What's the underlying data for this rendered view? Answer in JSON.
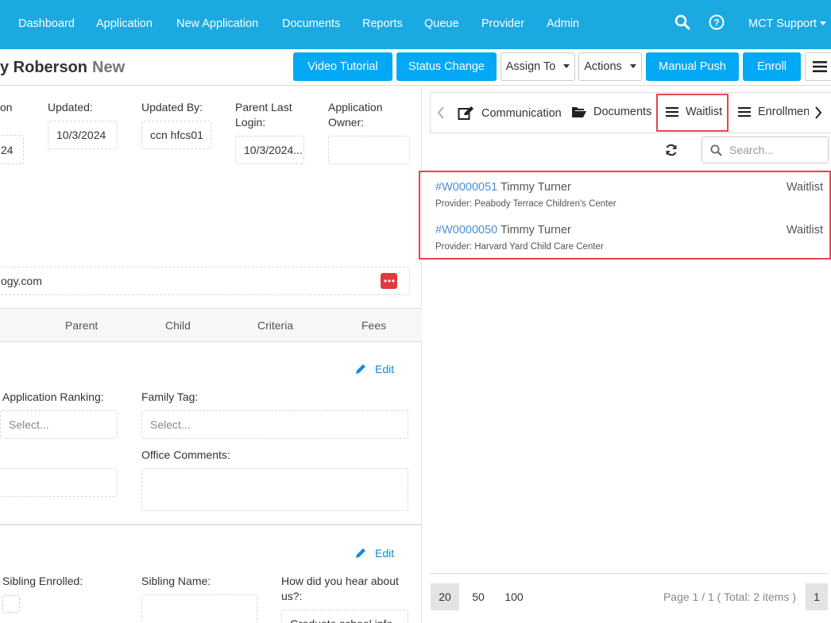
{
  "nav": {
    "items": [
      "Dashboard",
      "Application",
      "New Application",
      "Documents",
      "Reports",
      "Queue",
      "Provider",
      "Admin"
    ],
    "user": "MCT Support"
  },
  "header": {
    "title": "y Roberson",
    "status": "New",
    "buttons": {
      "video": "Video Tutorial",
      "status_change": "Status Change",
      "assign_to": "Assign To",
      "actions": "Actions",
      "manual_push": "Manual Push",
      "enroll": "Enroll"
    }
  },
  "form": {
    "on_label": "on",
    "on_value": "24",
    "updated_label": "Updated:",
    "updated_value": "10/3/2024",
    "updated_by_label": "Updated By:",
    "updated_by_value": "ccn hfcs01",
    "parent_login_label": "Parent Last Login:",
    "parent_login_value": "10/3/2024...",
    "owner_label": "Application Owner:",
    "owner_value": "",
    "email_value": "ogy.com",
    "tabs": [
      "Parent",
      "Child",
      "Criteria",
      "Fees"
    ],
    "edit_label": "Edit",
    "ranking_label": "Application Ranking:",
    "ranking_placeholder": "Select...",
    "family_tag_label": "Family Tag:",
    "family_tag_placeholder": "Select...",
    "office_comments_label": "Office Comments:",
    "sibling_enrolled_label": "Sibling Enrolled:",
    "sibling_name_label": "Sibling Name:",
    "hear_about_label": "How did you hear about us?:",
    "hear_about_value": "Graduate school info..."
  },
  "right": {
    "tabs": {
      "communication": "Communication",
      "documents": "Documents",
      "waitlist": "Waitlist",
      "enrollment": "Enrollment"
    },
    "search_placeholder": "Search...",
    "waitlist": [
      {
        "id": "#W0000051",
        "child": "Timmy Turner",
        "provider": "Provider: Peabody Terrace Children's Center",
        "status": "Waitlist"
      },
      {
        "id": "#W0000050",
        "child": "Timmy Turner",
        "provider": "Provider: Harvard Yard Child Care Center",
        "status": "Waitlist"
      }
    ],
    "page_sizes": [
      "20",
      "50",
      "100"
    ],
    "page_info": "Page 1 / 1 ( Total: 2 items )",
    "current_page": "1"
  },
  "colors": {
    "nav_bg": "#1ba9e1",
    "primary_button": "#03a9f4",
    "highlight": "#e8454c",
    "link": "#4a90d9"
  }
}
